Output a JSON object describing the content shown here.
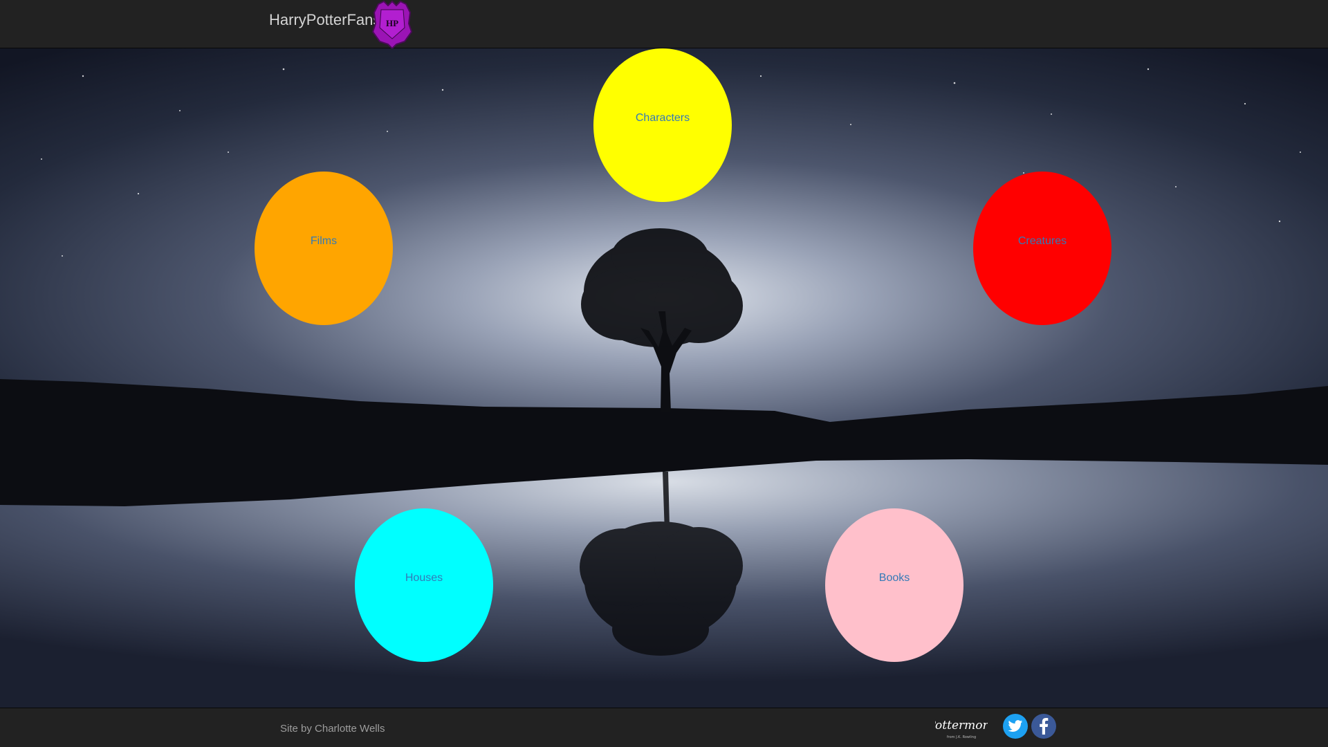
{
  "header": {
    "brand": "HarryPotterFans",
    "crest_icon": "hogwarts-crest-icon",
    "crest_text": "HP",
    "crest_color": "#9b14b5"
  },
  "nav_circles": [
    {
      "label": "Characters",
      "color": "#ffff00"
    },
    {
      "label": "Films",
      "color": "#ffa500"
    },
    {
      "label": "Creatures",
      "color": "#ff0000"
    },
    {
      "label": "Houses",
      "color": "#00ffff"
    },
    {
      "label": "Books",
      "color": "#ffc0cb"
    }
  ],
  "footer": {
    "credit": "Site by Charlotte Wells",
    "pottermore": "Pottermore",
    "pottermore_sub": "from J.K. Rowling",
    "twitter_icon": "twitter-icon",
    "facebook_icon": "facebook-icon",
    "twitter_color": "#1da1f2",
    "facebook_color": "#3b5998"
  },
  "link_color": "#337ab7"
}
